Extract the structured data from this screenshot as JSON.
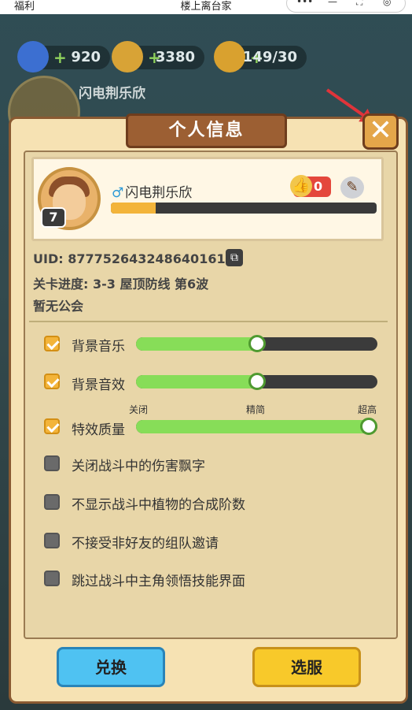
{
  "topbar": {
    "left_text": "福利",
    "center_text": "楼上离台家"
  },
  "hud": {
    "gems": "920",
    "coins": "3380",
    "energy": "149/30"
  },
  "background_name": "闪电荆乐欣",
  "dialog": {
    "title": "个人信息",
    "close_label": "✕",
    "profile": {
      "nickname": "闪电荆乐欣",
      "gender_icon": "male-icon",
      "level": "7",
      "xp_progress": 0.17,
      "likes": "0"
    },
    "uid": "UID: 877752643248640161",
    "stage_progress": "关卡进度: 3-3  屋顶防线 第6波",
    "guild": "暂无公会",
    "settings": [
      {
        "label": "背景音乐",
        "checked": true,
        "slider": 0.5
      },
      {
        "label": "背景音效",
        "checked": true,
        "slider": 0.5
      },
      {
        "label": "特效质量",
        "checked": true,
        "slider": 1.0
      },
      {
        "label": "关闭战斗中的伤害飘字",
        "checked": false
      },
      {
        "label": "不显示战斗中植物的合成阶数",
        "checked": false
      },
      {
        "label": "不接受非好友的组队邀请",
        "checked": false
      },
      {
        "label": "跳过战斗中主角领悟技能界面",
        "checked": false
      }
    ],
    "quality_marks": [
      "关闭",
      "精简",
      "超高"
    ],
    "buttons": {
      "exchange": "兑换",
      "select_server": "选服"
    }
  },
  "colors": {
    "accent": "#87dd58",
    "gold": "#f3b43a",
    "blue_btn": "#4fc2f2",
    "yellow_btn": "#f8c92a"
  }
}
